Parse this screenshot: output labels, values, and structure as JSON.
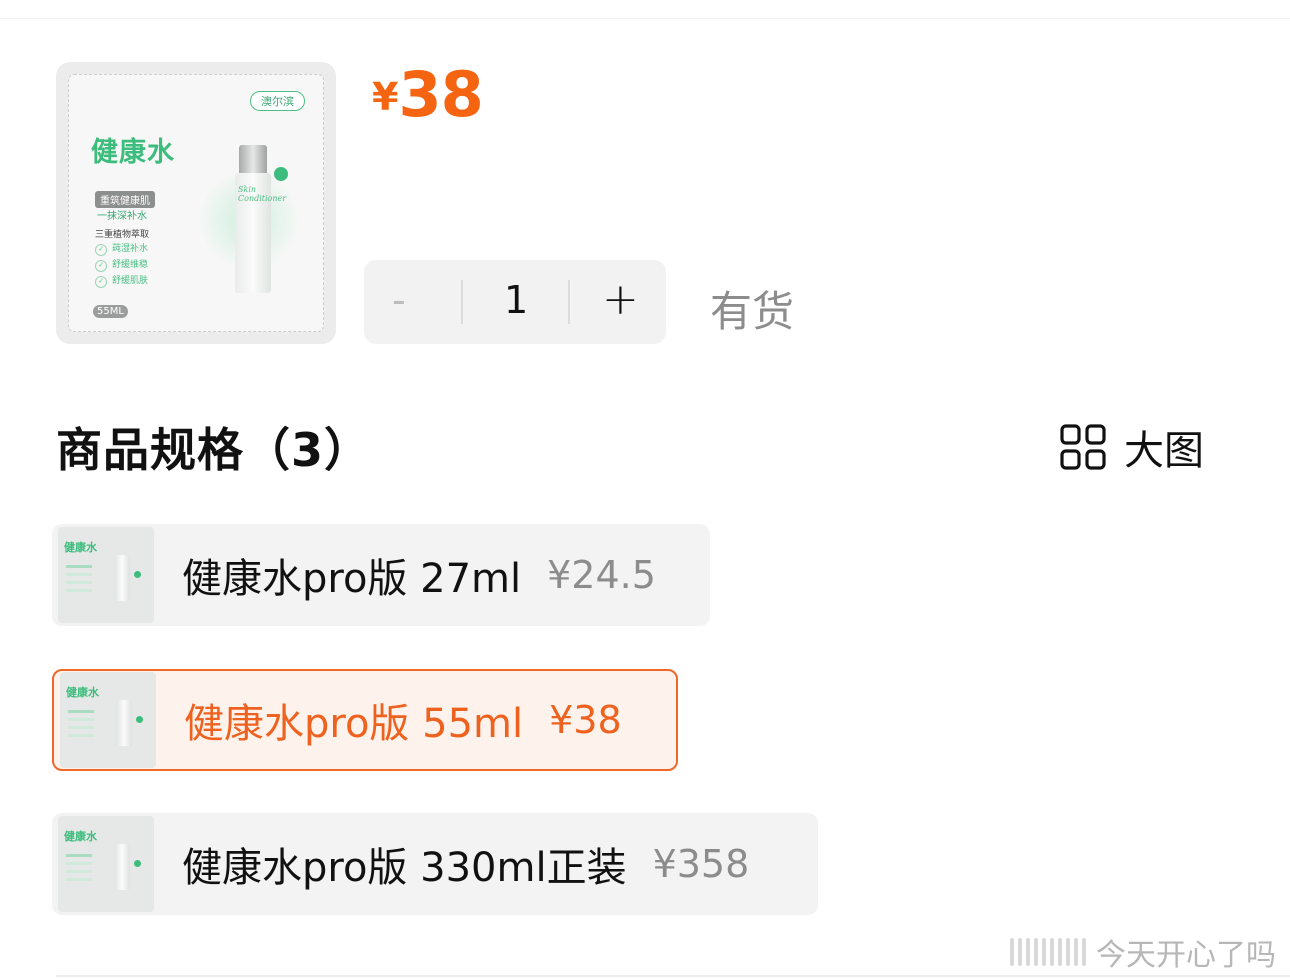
{
  "product": {
    "price_currency": "¥",
    "price_value": "38",
    "image": {
      "brand_tag": "澳尔滨",
      "headline": "健康水",
      "pill": "重筑健康肌",
      "sub": "一抹深补水",
      "section": "三重植物萃取",
      "bullets": [
        "莼湿补水",
        "舒缓维稳",
        "舒缓肌肤"
      ],
      "size": "55ML",
      "bottle_script": "Skin Conditioner"
    }
  },
  "quantity": {
    "minus_label": "-",
    "value": "1",
    "plus_label": "+",
    "stock_status": "有货"
  },
  "specs": {
    "title": "商品规格（3）",
    "view_toggle_label": "大图",
    "thumb_headline": "健康水",
    "options": [
      {
        "name": "健康水pro版 27ml",
        "price": "¥24.5",
        "selected": false
      },
      {
        "name": "健康水pro版 55ml",
        "price": "¥38",
        "selected": true
      },
      {
        "name": "健康水pro版 330ml正装",
        "price": "¥358",
        "selected": false
      }
    ]
  },
  "watermark": {
    "text": "今天开心了吗"
  },
  "colors": {
    "accent": "#f56411",
    "brand_green": "#3dbd7d",
    "muted": "#8c8c8c"
  }
}
